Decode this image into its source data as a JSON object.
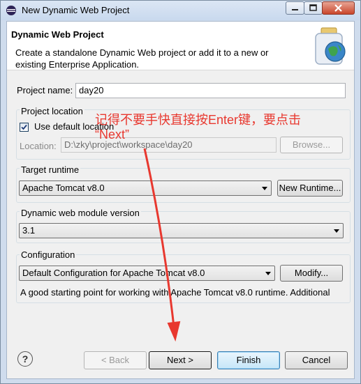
{
  "window": {
    "title": "New Dynamic Web Project"
  },
  "banner": {
    "title": "Dynamic Web Project",
    "description": "Create a standalone Dynamic Web project or add it to a new or existing Enterprise Application."
  },
  "project_name": {
    "label": "Project name:",
    "value": "day20"
  },
  "project_location": {
    "group_label": "Project location",
    "use_default_label": "Use default location",
    "use_default_checked": true,
    "location_label": "Location:",
    "location_value": "D:\\zky\\project\\workspace\\day20",
    "browse_label": "Browse..."
  },
  "target_runtime": {
    "group_label": "Target runtime",
    "selected": "Apache Tomcat v8.0",
    "new_runtime_label": "New Runtime..."
  },
  "module_version": {
    "group_label": "Dynamic web module version",
    "selected": "3.1"
  },
  "configuration": {
    "group_label": "Configuration",
    "selected": "Default Configuration for Apache Tomcat v8.0",
    "modify_label": "Modify...",
    "description": "A good starting point for working with Apache Tomcat v8.0 runtime. Additional"
  },
  "buttons": {
    "back": "< Back",
    "next": "Next >",
    "finish": "Finish",
    "cancel": "Cancel",
    "help": "?"
  },
  "annotation": {
    "line1": "记得不要手快直接按Enter键，要点击",
    "line2": "“Next”",
    "color": "#e8382f"
  },
  "icons": [
    "eclipse-icon",
    "minimize-icon",
    "maximize-icon",
    "close-icon",
    "web-project-wizard-icon",
    "checkbox-check-icon",
    "help-icon",
    "dropdown-arrow-icon"
  ]
}
